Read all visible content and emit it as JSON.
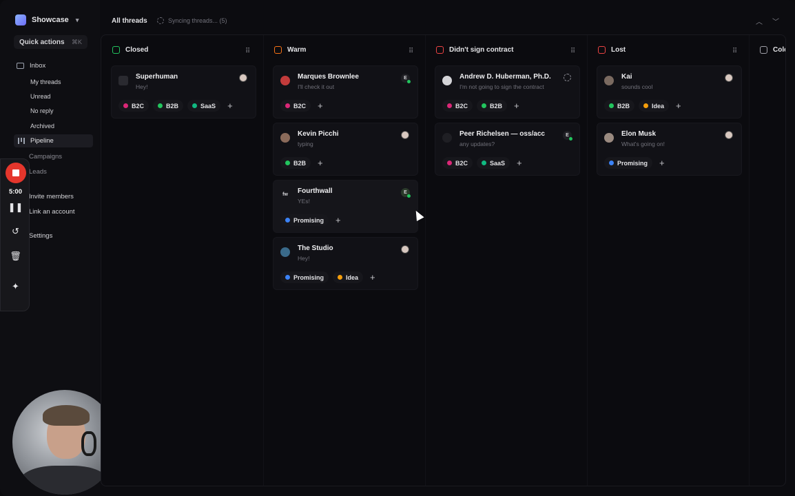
{
  "workspace": {
    "name": "Showcase"
  },
  "quick_actions": {
    "label": "Quick actions",
    "shortcut": "⌘K"
  },
  "nav": {
    "inbox": "Inbox",
    "inbox_items": [
      "My threads",
      "Unread",
      "No reply",
      "Archived"
    ],
    "pipeline": "Pipeline",
    "campaigns": "Campaigns",
    "leads": "Leads",
    "invite": "Invite members",
    "link": "Link an account",
    "settings": "Settings"
  },
  "recorder": {
    "time": "5:00"
  },
  "topbar": {
    "title": "All threads",
    "sync": "Syncing threads... (5)"
  },
  "colors": {
    "closed": "#22c55e",
    "warm": "#f97316",
    "didnt_sign": "#ef4444",
    "lost": "#ef4444",
    "cold": "#a1a1aa",
    "B2C": "#db2777",
    "B2B": "#22c55e",
    "SaaS": "#10b981",
    "Promising": "#3b82f6",
    "Idea": "#f59e0b"
  },
  "columns": [
    {
      "title": "Closed",
      "cards": [
        {
          "name": "Superhuman",
          "message": "Hey!",
          "owner": "avatar",
          "tags": [
            "B2C",
            "B2B",
            "SaaS"
          ]
        }
      ]
    },
    {
      "title": "Warm",
      "cards": [
        {
          "name": "Marques Brownlee",
          "message": "I'll check it out",
          "owner": "E",
          "tags": [
            "B2C"
          ]
        },
        {
          "name": "Kevin Picchi",
          "message": "typing",
          "owner": "avatar",
          "tags": [
            "B2B"
          ]
        },
        {
          "name": "Fourthwall",
          "message": "YEs!",
          "owner": "E",
          "avatar_text": "fw",
          "tags": [
            "Promising"
          ]
        },
        {
          "name": "The Studio",
          "message": "Hey!",
          "owner": "avatar",
          "tags": [
            "Promising",
            "Idea"
          ]
        }
      ]
    },
    {
      "title": "Didn't sign contract",
      "cards": [
        {
          "name": "Andrew D. Huberman, Ph.D.",
          "message": "I'm not going to sign the contract",
          "owner": "dashed",
          "tags": [
            "B2C",
            "B2B"
          ]
        },
        {
          "name": "Peer Richelsen — oss/acc",
          "message": "any updates?",
          "owner": "E",
          "tags": [
            "B2C",
            "SaaS"
          ]
        }
      ]
    },
    {
      "title": "Lost",
      "cards": [
        {
          "name": "Kai",
          "message": "sounds cool",
          "owner": "avatar",
          "tags": [
            "B2B",
            "Idea"
          ]
        },
        {
          "name": "Elon Musk",
          "message": "What's going on!",
          "owner": "avatar",
          "tags": [
            "Promising"
          ]
        }
      ]
    },
    {
      "title": "Cold",
      "cards": []
    }
  ]
}
